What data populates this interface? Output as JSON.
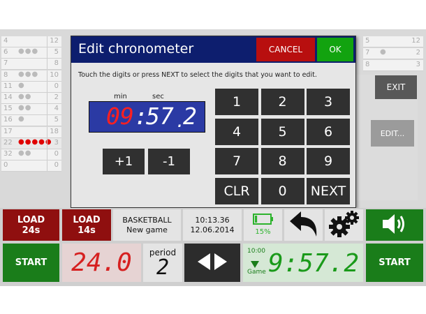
{
  "background_rows_left": [
    {
      "num": "4",
      "dots": "",
      "rnum": "12"
    },
    {
      "num": "6",
      "dots": "●●●",
      "rnum": "5"
    },
    {
      "num": "7",
      "dots": "",
      "rnum": "8"
    },
    {
      "num": "8",
      "dots": "●●●",
      "rnum": "10"
    },
    {
      "num": "11",
      "dots": "●",
      "rnum": "0"
    },
    {
      "num": "14",
      "dots": "●●",
      "rnum": "2"
    },
    {
      "num": "15",
      "dots": "●●",
      "rnum": "4"
    },
    {
      "num": "16",
      "dots": "●",
      "rnum": "5"
    },
    {
      "num": "17",
      "dots": "",
      "rnum": "18"
    },
    {
      "num": "22",
      "dots": "●●●●●",
      "rnum": "3",
      "foul_out": true
    },
    {
      "num": "32",
      "dots": "●●",
      "rnum": "0"
    },
    {
      "num": "0",
      "dots": "",
      "rnum": "0"
    }
  ],
  "background_rows_right": [
    {
      "num": "5",
      "dots": "",
      "rnum": "12"
    },
    {
      "num": "7",
      "dots": "●",
      "rnum": "2"
    },
    {
      "num": "8",
      "dots": "",
      "rnum": "3"
    }
  ],
  "dialog": {
    "title": "Edit chronometer",
    "cancel_label": "CANCEL",
    "ok_label": "OK",
    "instruction": "Touch the digits or press NEXT to select the digits that you want to edit.",
    "min_label": "min",
    "sec_label": "sec",
    "chrono": {
      "minutes": "09",
      "colon": ":",
      "seconds": "57",
      "dot": ".",
      "tenths": "2"
    },
    "plus_label": "+1",
    "minus_label": "-1",
    "keys": [
      "1",
      "2",
      "3",
      "4",
      "5",
      "6",
      "7",
      "8",
      "9",
      "CLR",
      "0",
      "NEXT"
    ]
  },
  "side": {
    "exit_label": "EXIT",
    "edit_label": "EDIT..."
  },
  "bottom": {
    "load24_label": "LOAD\n24s",
    "load14_label": "LOAD\n14s",
    "sport": "BASKETBALL",
    "game_status": "New game",
    "time": "10:13.36",
    "date": "12.06.2014",
    "battery_percent": "15%",
    "battery_level": 0.15,
    "start_left_label": "START",
    "shot_clock": "24.0",
    "period_label": "period",
    "period_value": "2",
    "game_period_time": "10:00",
    "game_label": "Game",
    "game_clock": "9:57.2",
    "start_right_label": "START"
  },
  "colors": {
    "header_blue": "#0d1e6e",
    "cancel_red": "#b80f0f",
    "ok_green": "#12a30f",
    "chrono_bg": "#2b3aa4",
    "digit_red": "#ff2020",
    "load_red": "#8f0f0f",
    "start_green": "#1a7d1a",
    "battery_green": "#2db32d"
  },
  "icons": [
    "undo-arrow-icon",
    "settings-gears-icon",
    "speaker-volume-icon",
    "left-right-arrows-icon",
    "battery-icon",
    "triangle-down-icon"
  ]
}
